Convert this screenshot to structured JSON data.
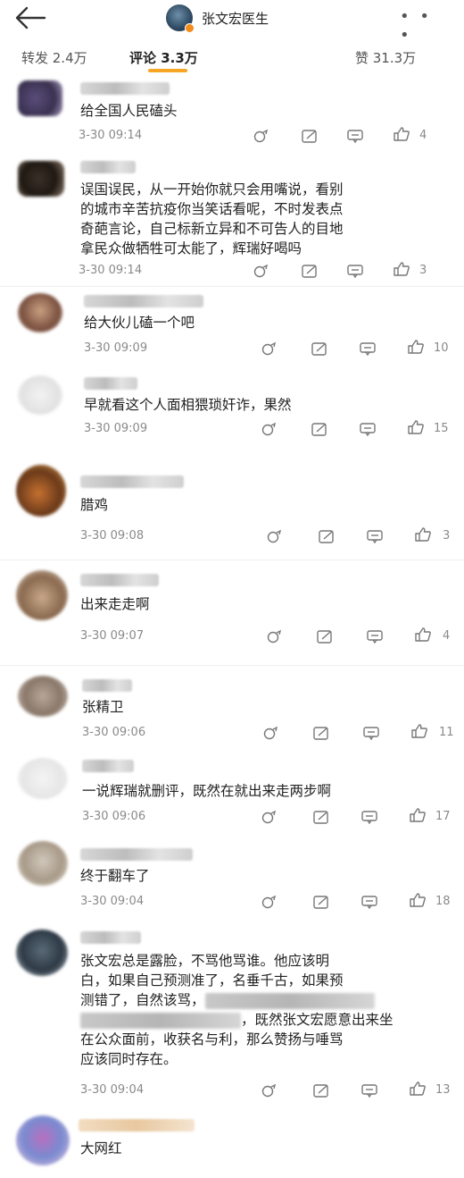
{
  "header": {
    "account_name": "张文宏医生",
    "more_glyph": "• • •"
  },
  "tabs": {
    "repost": "转发 2.4万",
    "comments": "评论 3.3万",
    "likes": "赞 31.3万"
  },
  "comments": [
    {
      "text": "给全国人民磕头",
      "time": "3-30 09:14",
      "likes": "4"
    },
    {
      "text_lines": [
        "误国误民，从一开始你就只会用嘴说，看别",
        "的城市辛苦抗疫你当笑话看呢，不时发表点",
        "奇葩言论，自己标新立异和不可告人的目地",
        "拿民众做牺牲可太能了，辉瑞好喝吗"
      ],
      "time": "3-30 09:14",
      "likes": "3"
    },
    {
      "text": "给大伙儿磕一个吧",
      "time": "3-30 09:09",
      "likes": "10"
    },
    {
      "text": "早就看这个人面相猥琐奸诈，果然",
      "time": "3-30 09:09",
      "likes": "15"
    },
    {
      "text": "腊鸡",
      "time": "3-30 09:08",
      "likes": "3"
    },
    {
      "text": "出来走走啊",
      "time": "3-30 09:07",
      "likes": "4"
    },
    {
      "text": "张精卫",
      "time": "3-30 09:06",
      "likes": "11"
    },
    {
      "text": "一说辉瑞就删评，既然在就出来走两步啊",
      "time": "3-30 09:06",
      "likes": "17"
    },
    {
      "text": "终于翻车了",
      "time": "3-30 09:04",
      "likes": "18"
    },
    {
      "text_lines": [
        "张文宏总是露脸，不骂他骂谁。他应该明",
        "白，如果自己预测准了，名垂千古，如果预",
        "测错了，自然该骂，",
        "",
        "在公众面前，收获名与利，那么赞扬与唾骂",
        "应该同时存在。"
      ],
      "text_line4_tail": "，既然张文宏愿意出来坐",
      "time": "3-30 09:04",
      "likes": "13"
    },
    {
      "text": "大网红"
    }
  ]
}
